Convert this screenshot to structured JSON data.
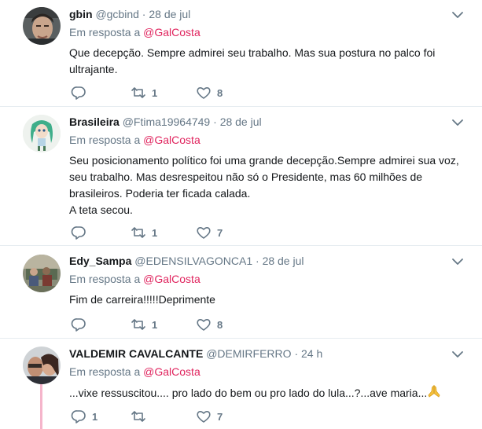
{
  "tweets": [
    {
      "name": "gbin",
      "handle": "@gcbind",
      "time": "28 de jul",
      "reply_label": "Em resposta a",
      "reply_mention": "@GalCosta",
      "lines": [
        "Que decepção. Sempre admirei seu trabalho. Mas sua postura no palco foi",
        "ultrajante."
      ],
      "reply_count": "",
      "retweet_count": "1",
      "like_count": "8"
    },
    {
      "name": "Brasileira",
      "handle": "@Ftima19964749",
      "time": "28 de jul",
      "reply_label": "Em resposta a",
      "reply_mention": "@GalCosta",
      "lines": [
        "Seu posicionamento político foi uma grande decepção.Sempre admirei sua voz,",
        "seu trabalho. Mas desrespeitou não só o Presidente, mas 60 milhões de",
        "brasileiros. Poderia ter ficada calada.",
        "A teta secou."
      ],
      "reply_count": "",
      "retweet_count": "1",
      "like_count": "7"
    },
    {
      "name": "Edy_Sampa",
      "handle": "@EDENSILVAGONCA1",
      "time": "28 de jul",
      "reply_label": "Em resposta a",
      "reply_mention": "@GalCosta",
      "lines": [
        "Fim de carreira!!!!!Deprimente"
      ],
      "reply_count": "",
      "retweet_count": "1",
      "like_count": "8"
    },
    {
      "name": "VALDEMIR CAVALCANTE",
      "handle": "@DEMIRFERRO",
      "time": "24 h",
      "reply_label": "Em resposta a",
      "reply_mention": "@GalCosta",
      "lines": [
        "...vixe ressuscitou.... pro lado do bem ou pro lado do lula...?...ave maria..."
      ],
      "reply_count": "1",
      "retweet_count": "",
      "like_count": "7"
    }
  ],
  "separator": "·",
  "icons": {
    "reply": "reply-icon",
    "retweet": "retweet-icon",
    "like": "heart-icon",
    "caret": "chevron-down-icon",
    "emoji": "folded-hands-emoji"
  },
  "colors": {
    "mention": "#e0245e",
    "muted": "#657786",
    "thread": "#f5b5cb"
  }
}
